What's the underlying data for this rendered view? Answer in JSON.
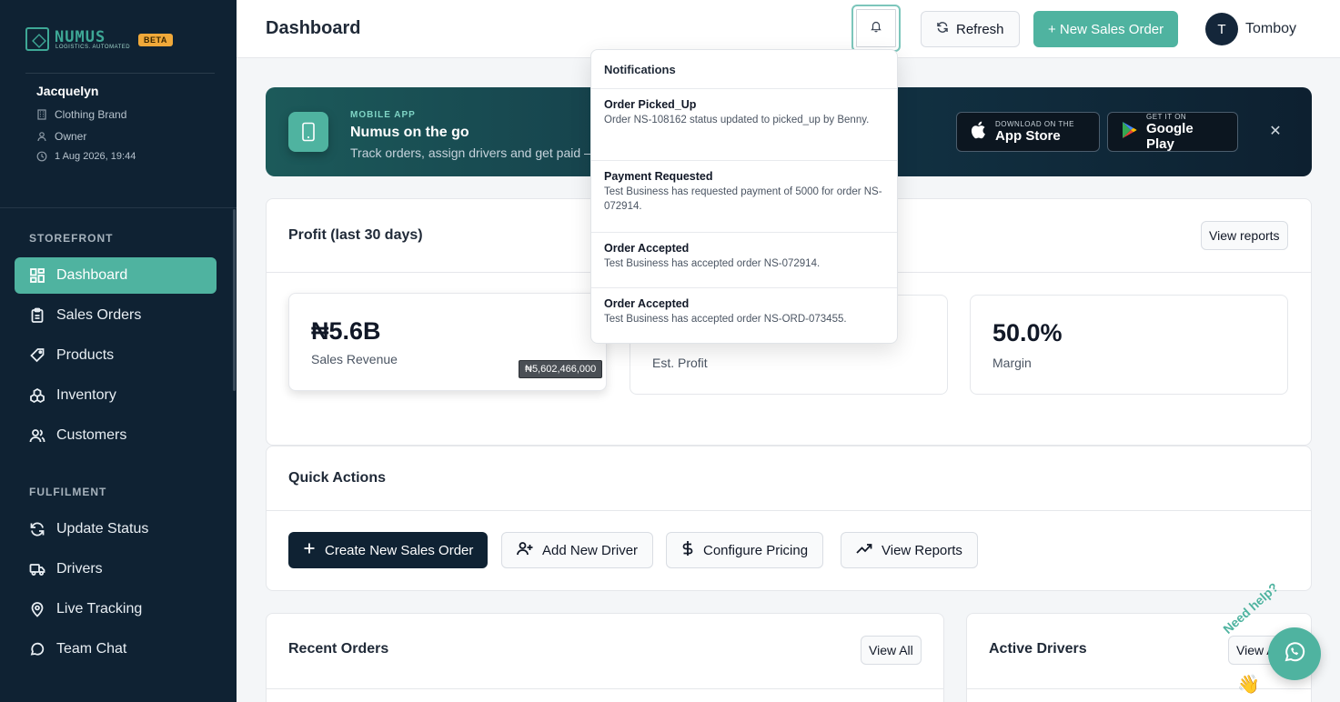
{
  "brand": {
    "name": "NUMUS",
    "tagline": "LOGISTICS. AUTOMATED",
    "badge": "BETA"
  },
  "profile": {
    "name": "Jacquelyn",
    "business": "Clothing Brand",
    "role": "Owner",
    "datetime": "1 Aug 2026, 19:44"
  },
  "sidebar": {
    "storefront_label": "STOREFRONT",
    "storefront_items": [
      {
        "label": "Dashboard",
        "icon": "grid-icon"
      },
      {
        "label": "Sales Orders",
        "icon": "clipboard-icon"
      },
      {
        "label": "Products",
        "icon": "tag-icon"
      },
      {
        "label": "Inventory",
        "icon": "boxes-icon"
      },
      {
        "label": "Customers",
        "icon": "users-icon"
      }
    ],
    "fulfilment_label": "FULFILMENT",
    "fulfilment_items": [
      {
        "label": "Update Status",
        "icon": "refresh-icon"
      },
      {
        "label": "Drivers",
        "icon": "truck-icon"
      },
      {
        "label": "Live Tracking",
        "icon": "map-pin-icon"
      },
      {
        "label": "Team Chat",
        "icon": "chat-icon"
      }
    ]
  },
  "header": {
    "title": "Dashboard",
    "refresh_label": "Refresh",
    "new_order_label": "+ New Sales Order",
    "avatar_initial": "T",
    "user_name": "Tomboy"
  },
  "banner": {
    "kicker": "MOBILE APP",
    "title": "Numus on the go",
    "text": "Track orders, assign drivers and get paid —",
    "app_store_small": "Download on the",
    "app_store_big": "App Store",
    "google_small": "GET IT ON",
    "google_big": "Google Play"
  },
  "profit": {
    "title": "Profit (last 30 days)",
    "view_reports": "View reports",
    "stats": [
      {
        "value": "₦5.6B",
        "label": "Sales Revenue"
      },
      {
        "value": "",
        "label": "Est. Profit"
      },
      {
        "value": "50.0%",
        "label": "Margin"
      }
    ],
    "tooltip": "₦5,602,466,000"
  },
  "quick_actions": {
    "title": "Quick Actions",
    "buttons": [
      "Create New Sales Order",
      "Add New Driver",
      "Configure Pricing",
      "View Reports"
    ]
  },
  "recent_orders": {
    "title": "Recent Orders",
    "view_all": "View All"
  },
  "active_drivers": {
    "title": "Active Drivers",
    "view_all": "View All"
  },
  "notifications": {
    "heading": "Notifications",
    "items": [
      {
        "title": "Order Picked_Up",
        "body": "Order NS-108162 status updated to picked_up by Benny."
      },
      {
        "title": "Payment Requested",
        "body": "Test Business has requested payment of 5000 for order NS-072914."
      },
      {
        "title": "Order Accepted",
        "body": "Test Business has accepted order NS-072914."
      },
      {
        "title": "Order Accepted",
        "body": "Test Business has accepted order NS-ORD-073455."
      }
    ]
  },
  "help": {
    "label": "Need help?",
    "emoji": "👋"
  },
  "colors": {
    "accent": "#4fb3a0",
    "sidebar": "#0f2233",
    "beta": "#f0a93a"
  }
}
